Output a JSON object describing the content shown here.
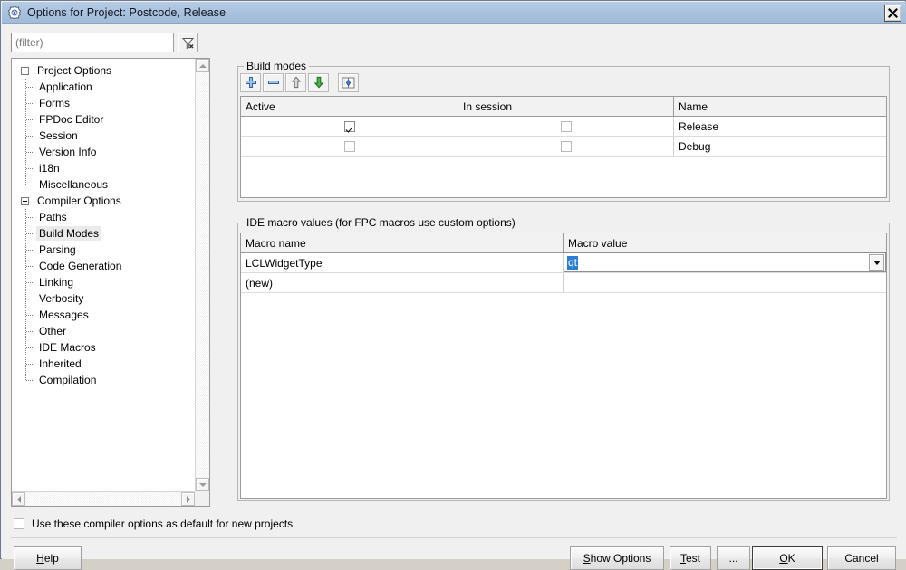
{
  "window": {
    "title": "Options for Project: Postcode, Release",
    "icon": "lazarus-app-icon",
    "close_label": "✖"
  },
  "left_pane": {
    "filter": {
      "value": "",
      "placeholder": "(filter)",
      "clear_button_icon": "filter-clear-icon"
    },
    "tree": [
      {
        "label": "Project Options",
        "level": 0,
        "expanded": true,
        "selected": false
      },
      {
        "label": "Application",
        "level": 1,
        "selected": false
      },
      {
        "label": "Forms",
        "level": 1,
        "selected": false
      },
      {
        "label": "FPDoc Editor",
        "level": 1,
        "selected": false
      },
      {
        "label": "Session",
        "level": 1,
        "selected": false
      },
      {
        "label": "Version Info",
        "level": 1,
        "selected": false
      },
      {
        "label": "i18n",
        "level": 1,
        "selected": false
      },
      {
        "label": "Miscellaneous",
        "level": 1,
        "selected": false,
        "last": true
      },
      {
        "label": "Compiler Options",
        "level": 0,
        "expanded": true,
        "selected": false
      },
      {
        "label": "Paths",
        "level": 1,
        "selected": false
      },
      {
        "label": "Build Modes",
        "level": 1,
        "selected": true
      },
      {
        "label": "Parsing",
        "level": 1,
        "selected": false
      },
      {
        "label": "Code Generation",
        "level": 1,
        "selected": false
      },
      {
        "label": "Linking",
        "level": 1,
        "selected": false
      },
      {
        "label": "Verbosity",
        "level": 1,
        "selected": false
      },
      {
        "label": "Messages",
        "level": 1,
        "selected": false
      },
      {
        "label": "Other",
        "level": 1,
        "selected": false
      },
      {
        "label": "IDE Macros",
        "level": 1,
        "selected": false
      },
      {
        "label": "Inherited",
        "level": 1,
        "selected": false
      },
      {
        "label": "Compilation",
        "level": 1,
        "selected": false,
        "last": true
      }
    ]
  },
  "build_modes": {
    "title": "Build modes",
    "toolbar": [
      {
        "name": "add-build-mode-button",
        "icon": "plus-icon"
      },
      {
        "name": "remove-build-mode-button",
        "icon": "minus-icon"
      },
      {
        "name": "move-up-button",
        "icon": "arrow-up-icon"
      },
      {
        "name": "move-down-button",
        "icon": "arrow-down-icon"
      },
      {
        "name": "diff-build-modes-button",
        "icon": "compare-icon"
      }
    ],
    "columns": [
      "Active",
      "In session",
      "Name"
    ],
    "rows": [
      {
        "active": true,
        "in_session": false,
        "name": "Release"
      },
      {
        "active": false,
        "in_session": false,
        "name": "Debug"
      }
    ]
  },
  "ide_macros": {
    "title": "IDE macro values (for FPC macros use custom options)",
    "columns": [
      "Macro name",
      "Macro value"
    ],
    "rows": [
      {
        "name": "LCLWidgetType",
        "value": "qt",
        "value_selected": true,
        "has_dropdown": true
      },
      {
        "name": "(new)",
        "value": "",
        "value_selected": false,
        "has_dropdown": false
      }
    ]
  },
  "footer": {
    "default_checkbox": {
      "label": "Use these compiler options as default for new projects",
      "checked": false
    },
    "buttons": {
      "help": {
        "label": "Help",
        "accel": "H",
        "focused": false
      },
      "show_options": {
        "label": "Show Options",
        "accel": "S",
        "focused": false
      },
      "test": {
        "label": "Test",
        "accel": "T",
        "focused": false
      },
      "dots": {
        "label": "...",
        "accel": "",
        "focused": false
      },
      "ok": {
        "label": "OK",
        "accel": "O",
        "focused": true
      },
      "cancel": {
        "label": "Cancel",
        "accel": "",
        "focused": false
      }
    }
  },
  "colors": {
    "titlebar": "#a9c2de",
    "dialog_bg": "#f0f0f0",
    "selection_blue": "#2a7fd4",
    "tree_selection": "#eaeaea",
    "grid_header": "#f2f2f2"
  }
}
